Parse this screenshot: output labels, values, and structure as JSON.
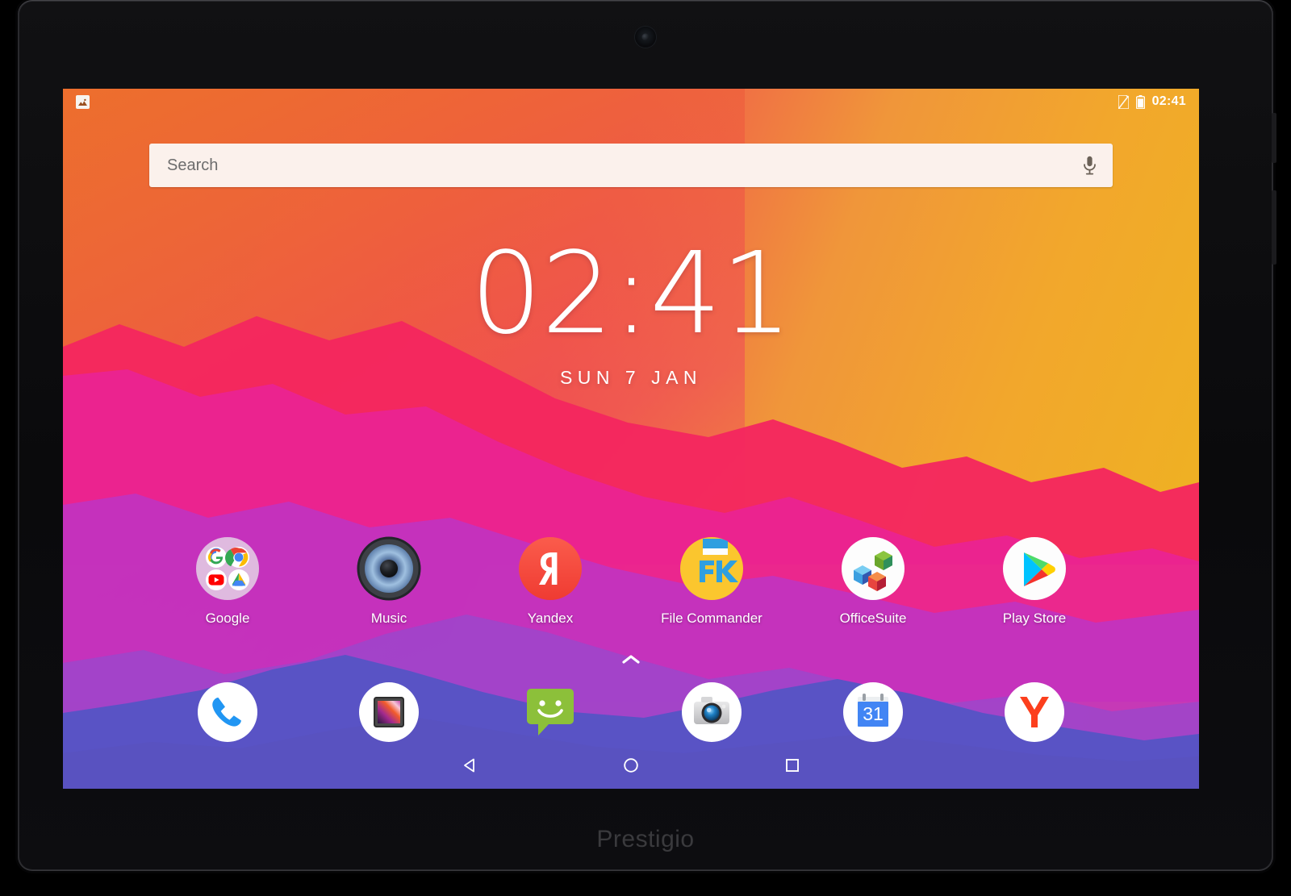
{
  "device": {
    "brand": "Prestigio",
    "camera_icon": "front-camera"
  },
  "statusbar": {
    "notification_icon": "image-notification-icon",
    "sim_icon": "no-sim-card-icon",
    "battery_icon": "battery-icon",
    "time": "02:41"
  },
  "search": {
    "placeholder": "Search",
    "value": "",
    "mic_icon": "microphone-icon"
  },
  "clock_widget": {
    "time": "02:41",
    "date": "SUN 7 JAN"
  },
  "apps": [
    {
      "label": "Google",
      "icon": "google-folder-icon"
    },
    {
      "label": "Music",
      "icon": "music-speaker-icon"
    },
    {
      "label": "Yandex",
      "icon": "yandex-icon"
    },
    {
      "label": "File Commander",
      "icon": "file-commander-icon"
    },
    {
      "label": "OfficeSuite",
      "icon": "officesuite-icon"
    },
    {
      "label": "Play Store",
      "icon": "play-store-icon"
    }
  ],
  "drawer": {
    "arrow_icon": "chevron-up-icon"
  },
  "dock": [
    {
      "label": "Phone",
      "icon": "phone-icon"
    },
    {
      "label": "Gallery",
      "icon": "gallery-icon"
    },
    {
      "label": "Messaging",
      "icon": "messaging-icon"
    },
    {
      "label": "Camera",
      "icon": "camera-icon"
    },
    {
      "label": "Calendar",
      "icon": "calendar-icon",
      "day": "31"
    },
    {
      "label": "Yandex Browser",
      "icon": "yandex-browser-icon"
    }
  ],
  "navbar": [
    {
      "label": "Back",
      "icon": "back-triangle-icon"
    },
    {
      "label": "Home",
      "icon": "home-circle-icon"
    },
    {
      "label": "Recents",
      "icon": "recents-square-icon"
    }
  ],
  "colors": {
    "wallpaper_sky_left": "#e8742e",
    "wallpaper_sky_right": "#edb51f",
    "wallpaper_band_red": "#f4275f",
    "wallpaper_band_pink": "#e6249b",
    "wallpaper_band_magenta": "#c233bd",
    "wallpaper_band_purple": "#8e49c8",
    "wallpaper_band_blue": "#5355c4",
    "search_bg": "#fbf1ec",
    "accent_yandex": "#f54d3d"
  }
}
